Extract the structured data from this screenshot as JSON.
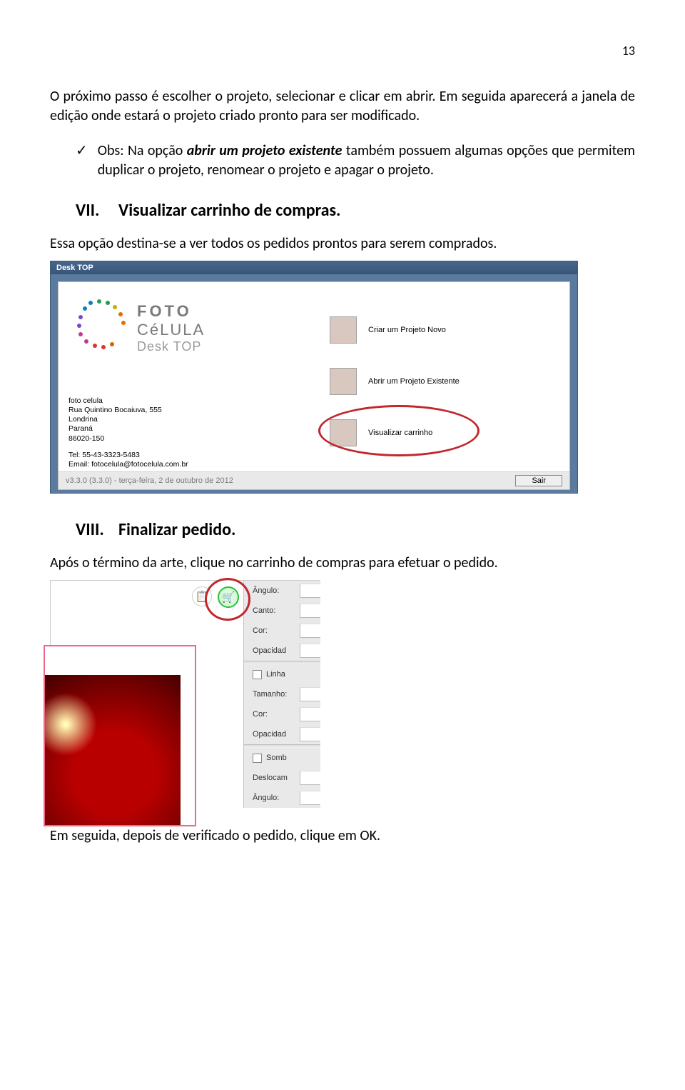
{
  "page_number": "13",
  "para_intro": "O próximo passo é escolher o projeto, selecionar e clicar em abrir. Em seguida aparecerá a janela de edição onde estará o projeto criado pronto para ser modificado.",
  "obs": {
    "prefix": "Obs:",
    "body": "Na opção abrir um projeto existente também possuem algumas opções que permitem duplicar o projeto, renomear o projeto e apagar o projeto.",
    "italic_fragment": "abrir um projeto existente"
  },
  "headings": {
    "vii_num": "VII.",
    "vii_text": "Visualizar carrinho de compras.",
    "vii_desc": "Essa opção destina-se a ver todos os pedidos prontos para serem comprados.",
    "viii_num": "VIII.",
    "viii_text": "Finalizar pedido.",
    "viii_desc": "Após o término da arte, clique no carrinho de compras para efetuar o pedido."
  },
  "shot1": {
    "title": "Desk TOP",
    "logo_line1": "FOTO",
    "logo_line2": "CéLULA",
    "logo_line3": "Desk TOP",
    "contact": [
      "foto celula",
      "Rua Quintino Bocaiuva, 555",
      "Londrina",
      "Paraná",
      "86020-150",
      "",
      "Tel: 55-43-3323-5483",
      "Email: fotocelula@fotocelula.com.br"
    ],
    "btn1": "Criar um Projeto Novo",
    "btn2": "Abrir um Projeto Existente",
    "btn3": "Visualizar carrinho",
    "exit": "Sair",
    "version": "v3.3.0 (3.3.0) - terça-feira, 2 de outubro de 2012"
  },
  "shot2": {
    "rows": {
      "angulo1": "Ângulo:",
      "canto": "Canto:",
      "cor1": "Cor:",
      "opac1": "Opacidad",
      "linha": "Linha",
      "tamanho": "Tamanho:",
      "cor2": "Cor:",
      "opac2": "Opacidad",
      "sombra": "Somb",
      "desloc": "Deslocam",
      "angulo2": "Ângulo:"
    }
  },
  "closing": "Em seguida, depois de verificado o pedido, clique em OK."
}
